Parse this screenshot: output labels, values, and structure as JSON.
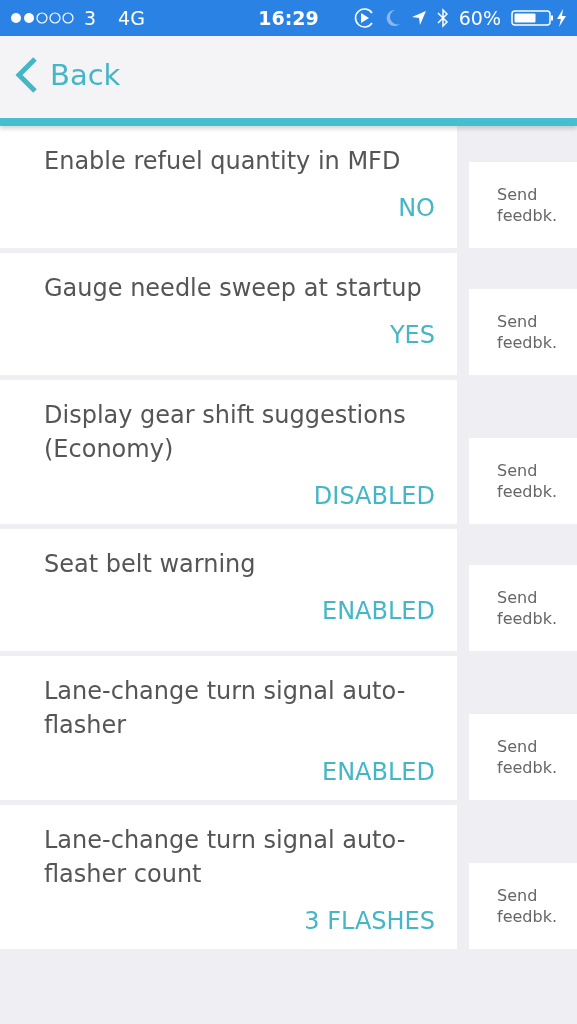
{
  "status_bar": {
    "carrier": "3",
    "network": "4G",
    "time": "16:29",
    "battery": "60%"
  },
  "nav": {
    "back": "Back"
  },
  "settings": [
    {
      "title": "Enable refuel quantity in MFD",
      "value": "NO",
      "feedback": "Send feedbk."
    },
    {
      "title": "Gauge needle sweep at startup",
      "value": "YES",
      "feedback": "Send feedbk."
    },
    {
      "title": "Display gear shift suggestions (Economy)",
      "value": "DISABLED",
      "feedback": "Send feedbk."
    },
    {
      "title": "Seat belt warning",
      "value": "ENABLED",
      "feedback": "Send feedbk."
    },
    {
      "title": "Lane-change turn signal auto-flasher",
      "value": "ENABLED",
      "feedback": "Send feedbk."
    },
    {
      "title": "Lane-change turn signal auto-flasher count",
      "value": "3 FLASHES",
      "feedback": "Send feedbk."
    }
  ]
}
